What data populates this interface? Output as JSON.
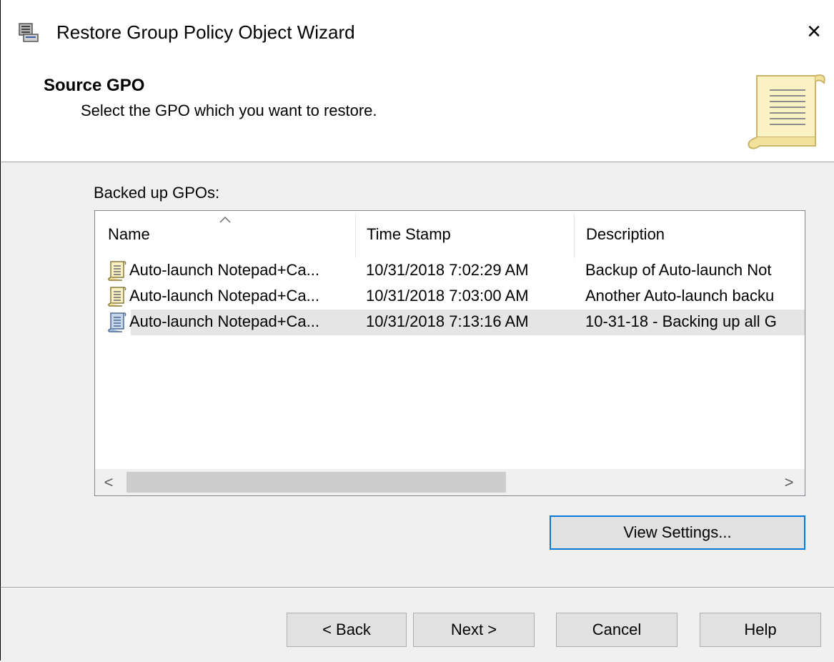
{
  "window": {
    "title": "Restore Group Policy Object Wizard",
    "close_glyph": "×"
  },
  "header": {
    "title": "Source GPO",
    "subtitle": "Select the GPO which you want to restore."
  },
  "list": {
    "label": "Backed up GPOs:",
    "columns": [
      "Name",
      "Time Stamp",
      "Description"
    ],
    "rows": [
      {
        "name": "Auto-launch Notepad+Ca...",
        "timestamp": "10/31/2018 7:02:29 AM",
        "description": "Backup of Auto-launch Not",
        "selected": false
      },
      {
        "name": "Auto-launch Notepad+Ca...",
        "timestamp": "10/31/2018 7:03:00 AM",
        "description": "Another Auto-launch backu",
        "selected": false
      },
      {
        "name": "Auto-launch Notepad+Ca...",
        "timestamp": "10/31/2018 7:13:16 AM",
        "description": "10-31-18 - Backing up all G",
        "selected": true
      }
    ],
    "scroll_left": "<",
    "scroll_right": ">"
  },
  "buttons": {
    "view_settings": "View Settings...",
    "back": "< Back",
    "next": "Next >",
    "cancel": "Cancel",
    "help": "Help"
  },
  "colors": {
    "dialog_bg": "#f0f0f0",
    "focus_border": "#0078d7",
    "button_bg": "#e1e1e1",
    "selected_row": "#e5e5e5"
  }
}
